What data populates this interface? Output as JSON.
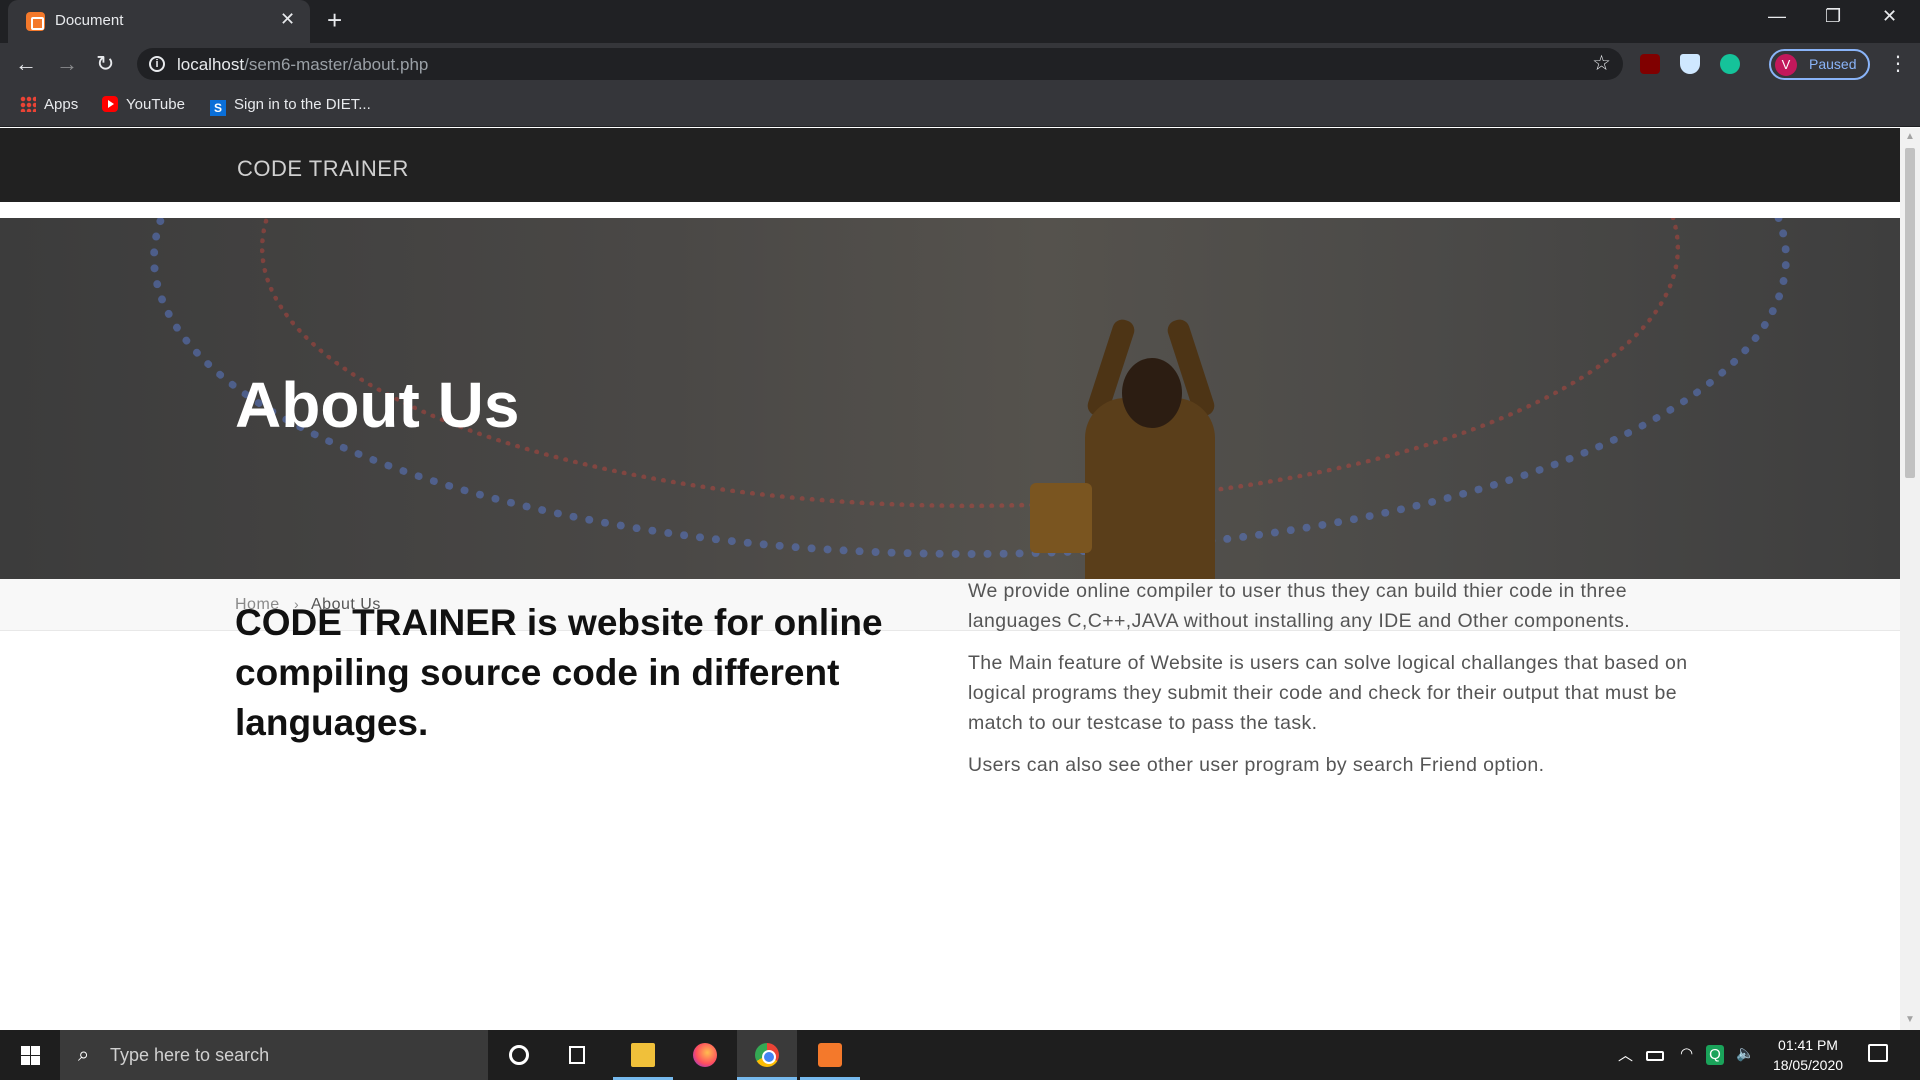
{
  "browser": {
    "tab_title": "Document",
    "url_host": "localhost",
    "url_path": "/sem6-master/about.php",
    "profile_initial": "V",
    "profile_status": "Paused",
    "bookmarks": [
      {
        "label": "Apps",
        "icon": "apps-grid-icon"
      },
      {
        "label": "YouTube",
        "icon": "youtube-icon"
      },
      {
        "label": "Sign in to the DIET...",
        "icon": "s-logo-icon"
      }
    ]
  },
  "site": {
    "brand": "CODE TRAINER",
    "hero_title": "About Us",
    "breadcrumb": {
      "home": "Home",
      "separator": "›",
      "current": "About Us"
    },
    "heading": "CODE TRAINER is website for online compiling source code in different languages.",
    "paragraphs": [
      "We provide online compiler to user thus they can build thier code in three languages C,C++,JAVA without installing any IDE and Other components.",
      "The Main feature of Website is users can solve logical challanges that based on logical programs they submit their code and check for their output that must be match to our testcase to pass the task.",
      "Users can also see other user program by search Friend option."
    ]
  },
  "taskbar": {
    "search_placeholder": "Type here to search",
    "time": "01:41 PM",
    "date": "18/05/2020"
  },
  "colors": {
    "site_nav_bg": "#212121",
    "accent_blue": "#8ab4f8",
    "xampp_orange": "#f4792b"
  }
}
